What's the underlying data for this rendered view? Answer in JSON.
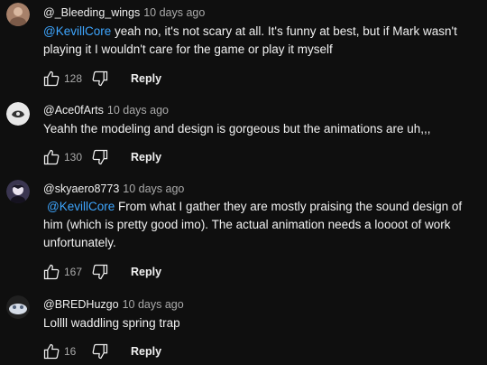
{
  "comments": [
    {
      "author": "@_Bleeding_wings",
      "time": "10 days ago",
      "mention": "@KevillCore",
      "text": " yeah no, it's not scary at all. It's funny at best, but if Mark wasn't playing it I wouldn't care for the game or play it myself",
      "likes": "128",
      "reply_label": "Reply",
      "avatar_color": "#a7816a"
    },
    {
      "author": "@Ace0fArts",
      "time": "10 days ago",
      "mention": "",
      "text": "Yeahh the modeling and design is gorgeous but the animations are uh,,,",
      "likes": "130",
      "reply_label": "Reply",
      "avatar_color": "#e8e8e8"
    },
    {
      "author": "@skyaero8773",
      "time": "10 days ago",
      "mention": "@KevillCore",
      "text": " From what I gather they are mostly praising the sound design of him (which is pretty good imo). The actual animation needs a loooot of work unfortunately.",
      "likes": "167",
      "reply_label": "Reply",
      "avatar_color": "#3a3550"
    },
    {
      "author": "@BREDHuzgo",
      "time": "10 days ago",
      "mention": "",
      "text": "Lollll waddling spring trap",
      "likes": "16",
      "reply_label": "Reply",
      "avatar_color": "#6a7d95"
    }
  ],
  "icons": {
    "like": "thumbs-up-icon",
    "dislike": "thumbs-down-icon"
  },
  "colors": {
    "background": "#0f0f0f",
    "mention": "#3ea6ff",
    "secondary_text": "#aaaaaa"
  }
}
